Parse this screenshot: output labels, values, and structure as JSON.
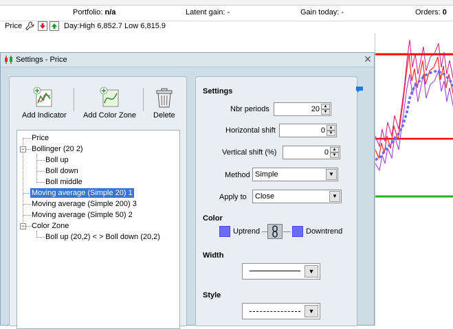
{
  "status": {
    "portfolio_label": "Portfolio:",
    "portfolio_value": "n/a",
    "latent_label": "Latent gain:",
    "latent_value": "-",
    "gain_today_label": "Gain today:",
    "gain_today_value": "-",
    "orders_label": "Orders:",
    "orders_value": "0"
  },
  "price_toolbar": {
    "label": "Price",
    "day_range": "Day:High 6,852.7 Low 6,815.9"
  },
  "dialog": {
    "title": "Settings - Price",
    "toolbar": {
      "add_indicator": "Add Indicator",
      "add_color_zone": "Add Color Zone",
      "delete": "Delete"
    },
    "tree": [
      {
        "label": "Price"
      },
      {
        "label": "Bollinger (20 2)"
      },
      {
        "label": "Boll up"
      },
      {
        "label": "Boll down"
      },
      {
        "label": "Boll middle"
      },
      {
        "label": "Moving average (Simple 20) 1"
      },
      {
        "label": "Moving average (Simple 200) 3"
      },
      {
        "label": "Moving average (Simple 50) 2"
      },
      {
        "label": "Color Zone"
      },
      {
        "label": "Boll up (20,2) < > Boll down (20,2)"
      }
    ],
    "expander_minus": "−",
    "settings": {
      "heading": "Settings",
      "nbr_periods_label": "Nbr periods",
      "nbr_periods": "20",
      "hshift_label": "Horizontal shift",
      "hshift": "0",
      "vshift_label": "Vertical shift (%)",
      "vshift": "0",
      "method_label": "Method",
      "method": "Simple",
      "apply_label": "Apply to",
      "apply": "Close",
      "color_heading": "Color",
      "uptrend": "Uptrend",
      "downtrend": "Downtrend",
      "width_heading": "Width",
      "style_heading": "Style"
    }
  },
  "colors": {
    "selection": "#3a74d4",
    "swatch": "#6b6bf5",
    "red_line": "#ff0000",
    "green_line": "#22b022"
  }
}
